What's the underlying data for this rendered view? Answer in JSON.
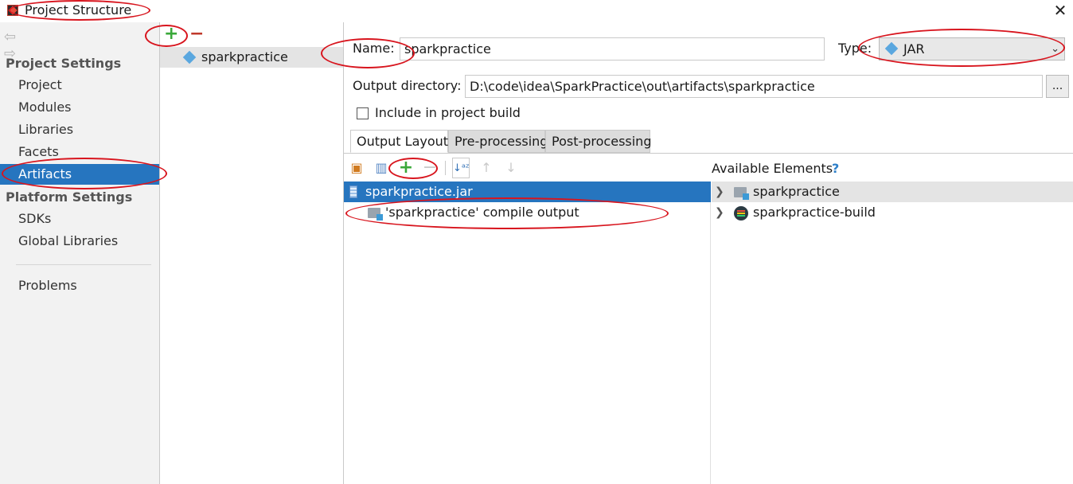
{
  "window": {
    "title": "Project Structure",
    "close_glyph": "✕"
  },
  "nav": {
    "back_glyph": "⇦",
    "forward_glyph": "⇨",
    "project_settings_heading": "Project Settings",
    "project_items": [
      "Project",
      "Modules",
      "Libraries",
      "Facets",
      "Artifacts"
    ],
    "platform_settings_heading": "Platform Settings",
    "platform_items": [
      "SDKs",
      "Global Libraries"
    ],
    "problems": "Problems",
    "selected": "Artifacts"
  },
  "artifacts_list": {
    "add_glyph": "+",
    "remove_glyph": "−",
    "items": [
      "sparkpractice"
    ]
  },
  "editor": {
    "name_label": "Name:",
    "name_value": "sparkpractice",
    "type_label": "Type:",
    "type_value": "JAR",
    "output_dir_label": "Output directory:",
    "output_dir_value": "D:\\code\\idea\\SparkPractice\\out\\artifacts\\sparkpractice",
    "browse_glyph": "...",
    "include_label": "Include in project build",
    "include_checked": false,
    "tabs": [
      "Output Layout",
      "Pre-processing",
      "Post-processing"
    ],
    "active_tab": "Output Layout"
  },
  "layout_tree": {
    "items": [
      "sparkpractice.jar",
      "'sparkpractice' compile output"
    ]
  },
  "available": {
    "heading": "Available Elements",
    "help_glyph": "?",
    "items": [
      "sparkpractice",
      "sparkpractice-build"
    ]
  },
  "colors": {
    "selection": "#2675bf",
    "annotation": "#d8151e",
    "add": "#3aa83a",
    "remove": "#c0392b"
  }
}
